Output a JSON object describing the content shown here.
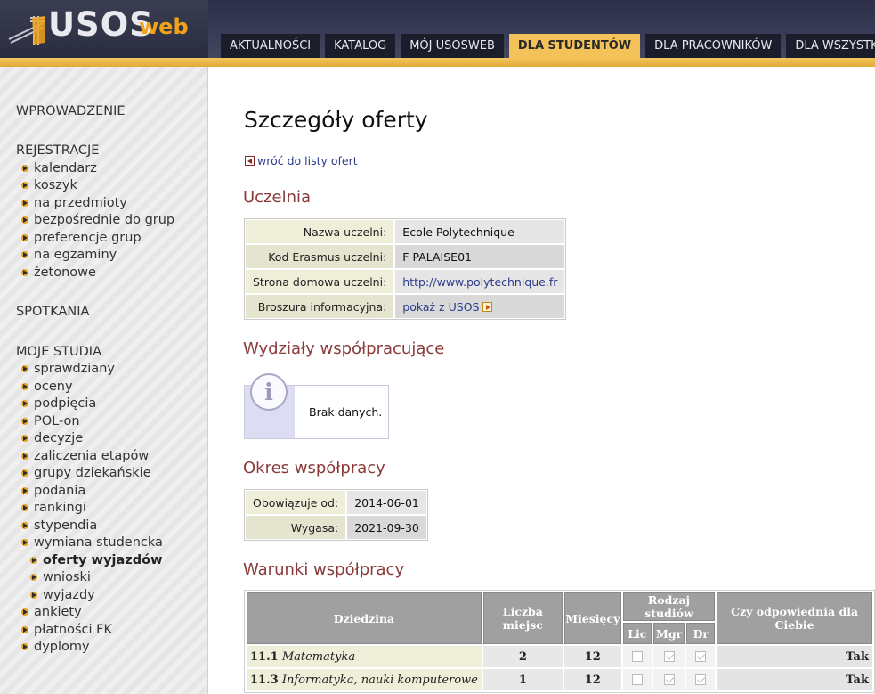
{
  "app": {
    "logo_main": "USOS",
    "logo_sub": "web"
  },
  "nav": {
    "tabs": [
      "AKTUALNOŚCI",
      "KATALOG",
      "MÓJ USOSWEB",
      "DLA STUDENTÓW",
      "DLA PRACOWNIKÓW",
      "DLA WSZYSTKICH"
    ],
    "active": "DLA STUDENTÓW"
  },
  "sidebar": {
    "wprowadzenie": "WPROWADZENIE",
    "rejestracje": "REJESTRACJE",
    "rejestracje_items": [
      "kalendarz",
      "koszyk",
      "na przedmioty",
      "bezpośrednie do grup",
      "preferencje grup",
      "na egzaminy",
      "żetonowe"
    ],
    "spotkania": "SPOTKANIA",
    "moje_studia": "MOJE STUDIA",
    "studia_items": [
      "sprawdziany",
      "oceny",
      "podpięcia",
      "POL-on",
      "decyzje",
      "zaliczenia etapów",
      "grupy dziekańskie",
      "podania",
      "rankingi",
      "stypendia",
      "wymiana studencka"
    ],
    "wymiana_sub": [
      "oferty wyjazdów",
      "wnioski",
      "wyjazdy"
    ],
    "studia_items2": [
      "ankiety",
      "płatności FK",
      "dyplomy"
    ]
  },
  "page": {
    "title": "Szczegóły oferty",
    "back": "wróć do listy ofert"
  },
  "uczelnia": {
    "heading": "Uczelnia",
    "rows": [
      {
        "k": "Nazwa uczelni:",
        "v": "Ecole Polytechnique"
      },
      {
        "k": "Kod Erasmus uczelni:",
        "v": "F PALAISE01"
      },
      {
        "k": "Strona domowa uczelni:",
        "v": "http://www.polytechnique.fr"
      },
      {
        "k": "Broszura informacyjna:",
        "v": "pokaż z USOS"
      }
    ]
  },
  "wydzialy": {
    "heading": "Wydziały współpracujące",
    "empty": "Brak danych.",
    "icon": "info-icon"
  },
  "okres": {
    "heading": "Okres współpracy",
    "rows": [
      {
        "k": "Obowiązuje od:",
        "v": "2014-06-01"
      },
      {
        "k": "Wygasa:",
        "v": "2021-09-30"
      }
    ]
  },
  "warunki": {
    "heading": "Warunki współpracy",
    "headers": {
      "dziedzina": "Dziedzina",
      "liczba": "Liczba miejsc",
      "miesiecy": "Miesięcy",
      "rodzaj": "Rodzaj studiów",
      "lic": "Lic",
      "mgr": "Mgr",
      "dr": "Dr",
      "czy": "Czy odpowiednia dla Ciebie"
    },
    "rows": [
      {
        "code": "11.1",
        "name": "Matematyka",
        "miejsca": "2",
        "miesiecy": "12",
        "lic": false,
        "mgr": true,
        "dr": true,
        "czy": "Tak"
      },
      {
        "code": "11.3",
        "name": "Informatyka, nauki komputerowe",
        "miejsca": "1",
        "miesiecy": "12",
        "lic": false,
        "mgr": true,
        "dr": true,
        "czy": "Tak"
      }
    ]
  }
}
